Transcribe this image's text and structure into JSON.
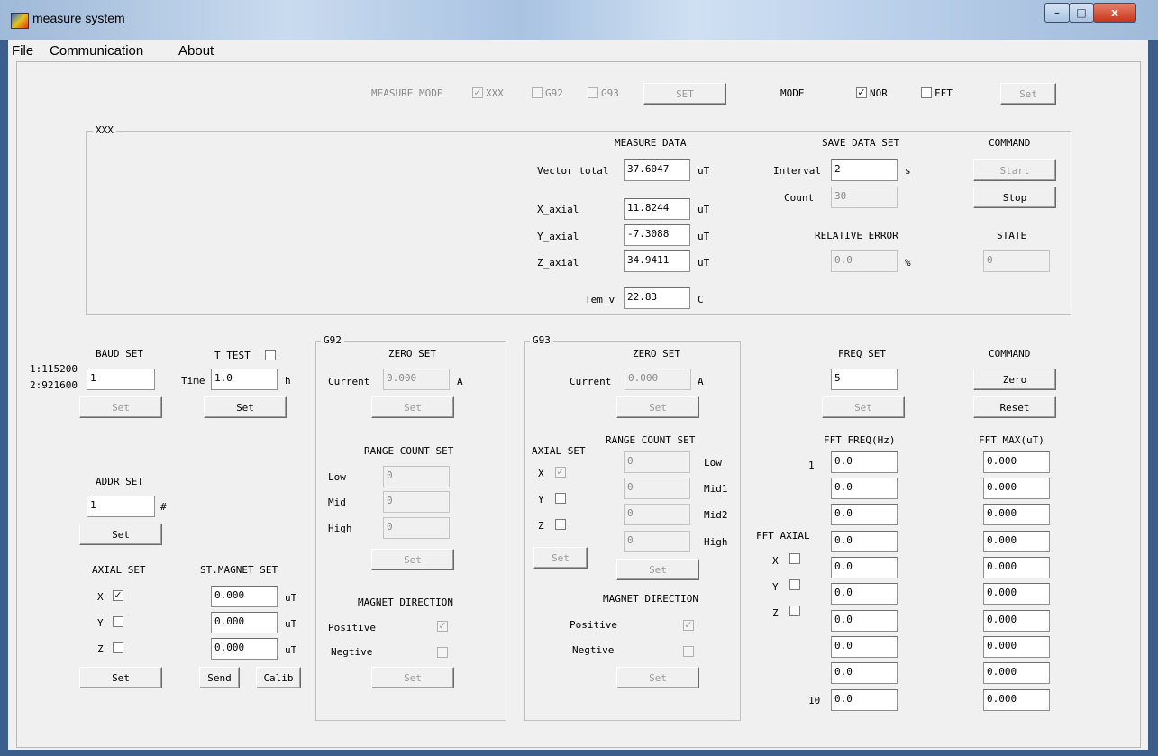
{
  "window": {
    "title": "measure system",
    "min_glyph": "–",
    "max_glyph": "□",
    "close_glyph": "x"
  },
  "menu": [
    "File",
    "Communication",
    "About"
  ],
  "top": {
    "measure_mode_label": "MEASURE MODE",
    "xxx": "XXX",
    "g92": "G92",
    "g93": "G93",
    "set_btn": "SET",
    "xxx_checked": true,
    "g92_checked": false,
    "g93_checked": false,
    "mode_label": "MODE",
    "nor": "NOR",
    "fft": "FFT",
    "nor_checked": true,
    "fft_checked": false,
    "set2": "Set"
  },
  "xxx_group": {
    "title": "XXX",
    "measure_data": "MEASURE DATA",
    "vector_total_label": "Vector total",
    "vector_total": "37.6047",
    "x_label": "X_axial",
    "x_value": "11.8244",
    "y_label": "Y_axial",
    "y_value": "-7.3088",
    "z_label": "Z_axial",
    "z_value": "34.9411",
    "unit_ut": "uT",
    "tem_label": "Tem_v",
    "tem_value": "22.83",
    "tem_unit": "C",
    "save_data_set": "SAVE DATA SET",
    "interval_label": "Interval",
    "interval": "2",
    "interval_unit": "s",
    "count_label": "Count",
    "count": "30",
    "relative_error": "RELATIVE ERROR",
    "rel_value": "0.0",
    "rel_unit": "%",
    "command": "COMMAND",
    "start": "Start",
    "stop": "Stop",
    "state": "STATE",
    "state_value": "0"
  },
  "baud": {
    "title": "BAUD SET",
    "opt1": "1:115200",
    "opt2": "2:921600",
    "value": "1",
    "set": "Set"
  },
  "ttest": {
    "title": "T TEST",
    "checked": false,
    "time_label": "Time",
    "value": "1.0",
    "unit": "h",
    "set": "Set"
  },
  "addr": {
    "title": "ADDR SET",
    "value": "1",
    "hash": "#",
    "set": "Set"
  },
  "axial": {
    "title": "AXIAL SET",
    "x": "X",
    "y": "Y",
    "z": "Z",
    "x_checked": true,
    "y_checked": false,
    "z_checked": false,
    "set": "Set"
  },
  "stmagnet": {
    "title": "ST.MAGNET SET",
    "values": [
      "0.000",
      "0.000",
      "0.000"
    ],
    "unit": "uT",
    "send": "Send",
    "calib": "Calib"
  },
  "g92": {
    "title": "G92",
    "zero_set": "ZERO SET",
    "current_label": "Current",
    "current": "0.000",
    "current_unit": "A",
    "set": "Set",
    "range_count_set": "RANGE COUNT SET",
    "low": "Low",
    "mid": "Mid",
    "high": "High",
    "low_v": "0",
    "mid_v": "0",
    "high_v": "0",
    "range_set": "Set",
    "magnet_direction": "MAGNET DIRECTION",
    "positive": "Positive",
    "negtive": "Negtive",
    "pos_checked": true,
    "neg_checked": false,
    "dir_set": "Set"
  },
  "g93": {
    "title": "G93",
    "zero_set": "ZERO SET",
    "current_label": "Current",
    "current": "0.000",
    "current_unit": "A",
    "set": "Set",
    "axial_set": "AXIAL SET",
    "x": "X",
    "y": "Y",
    "z": "Z",
    "x_checked": true,
    "y_checked": false,
    "z_checked": false,
    "axial_btn": "Set",
    "range_count_set": "RANGE COUNT SET",
    "low": "Low",
    "mid1": "Mid1",
    "mid2": "Mid2",
    "high": "High",
    "low_v": "0",
    "mid1_v": "0",
    "mid2_v": "0",
    "high_v": "0",
    "range_set": "Set",
    "magnet_direction": "MAGNET DIRECTION",
    "positive": "Positive",
    "negtive": "Negtive",
    "pos_checked": true,
    "neg_checked": false,
    "dir_set": "Set"
  },
  "freq": {
    "title": "FREQ SET",
    "value": "5",
    "set": "Set"
  },
  "command2": {
    "title": "COMMAND",
    "zero": "Zero",
    "reset": "Reset"
  },
  "fft": {
    "freq_title": "FFT FREQ(Hz)",
    "max_title": "FFT MAX(uT)",
    "first_index": "1",
    "last_index": "10",
    "freqs": [
      "0.0",
      "0.0",
      "0.0",
      "0.0",
      "0.0",
      "0.0",
      "0.0",
      "0.0",
      "0.0",
      "0.0"
    ],
    "maxes": [
      "0.000",
      "0.000",
      "0.000",
      "0.000",
      "0.000",
      "0.000",
      "0.000",
      "0.000",
      "0.000",
      "0.000"
    ],
    "axial_title": "FFT AXIAL",
    "x": "X",
    "y": "Y",
    "z": "Z"
  }
}
